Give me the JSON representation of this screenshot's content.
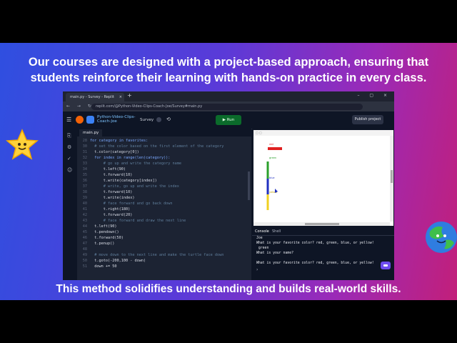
{
  "headline": {
    "line1": "Our courses are designed with a project-based approach, ensuring that",
    "line2": "students reinforce their learning with hands-on practice in every class."
  },
  "caption": "This method solidifies understanding and builds real-world skills.",
  "browser": {
    "tab_title": "main.py - Survey - Replit",
    "url": "replit.com/@Python-Video-Clips-Coach-Joe/Survey#main.py"
  },
  "replit": {
    "repl_name": "Python-Video-Clips-Coach-Joe",
    "project": "Survey",
    "run_label": "Run",
    "publish_label": "Publish project",
    "file_tab": "main.py",
    "console_tab": "Console",
    "shell_tab": "Shell"
  },
  "code_lines": [
    {
      "n": "28",
      "t": "for category in favorites:"
    },
    {
      "n": "30",
      "t": "  # set the color based on the first element of the category"
    },
    {
      "n": "31",
      "t": "  t.color(category[0])"
    },
    {
      "n": "32",
      "t": "  for index in range(len(category)):"
    },
    {
      "n": "33",
      "t": "      # go up and write the category name"
    },
    {
      "n": "34",
      "t": "      t.left(90)"
    },
    {
      "n": "35",
      "t": "      t.forward(10)"
    },
    {
      "n": "36",
      "t": "      t.write(category[index])"
    },
    {
      "n": "37",
      "t": "      # write, go up and write the index"
    },
    {
      "n": "38",
      "t": "      t.forward(10)"
    },
    {
      "n": "39",
      "t": "      t.write(index)"
    },
    {
      "n": "40",
      "t": "      # face forward and go back down"
    },
    {
      "n": "41",
      "t": "      t.right(180)"
    },
    {
      "n": "42",
      "t": "      t.forward(20)"
    },
    {
      "n": "43",
      "t": "      # face forward and draw the next line"
    },
    {
      "n": "44",
      "t": "  t.left(90)"
    },
    {
      "n": "45",
      "t": "  t.pendown()"
    },
    {
      "n": "46",
      "t": "  t.forward(50)"
    },
    {
      "n": "47",
      "t": "  t.penup()"
    },
    {
      "n": "48",
      "t": ""
    },
    {
      "n": "49",
      "t": "  # move down to the next line and make the turtle face down"
    },
    {
      "n": "50",
      "t": "  t.goto(-200,100 - down)"
    },
    {
      "n": "51",
      "t": "  down += 50"
    }
  ],
  "console_lines": [
    "Joe",
    "What is your favorite color? red, green, blue, or yellow!",
    " green",
    "What is your name?",
    "",
    "What is your favorite color? red, green, blue, or yellow!"
  ],
  "turtle_labels": [
    "red",
    "green",
    "blue",
    "yellow"
  ],
  "colors": {
    "run": "#0b6b2b",
    "accent": "#f26207"
  }
}
